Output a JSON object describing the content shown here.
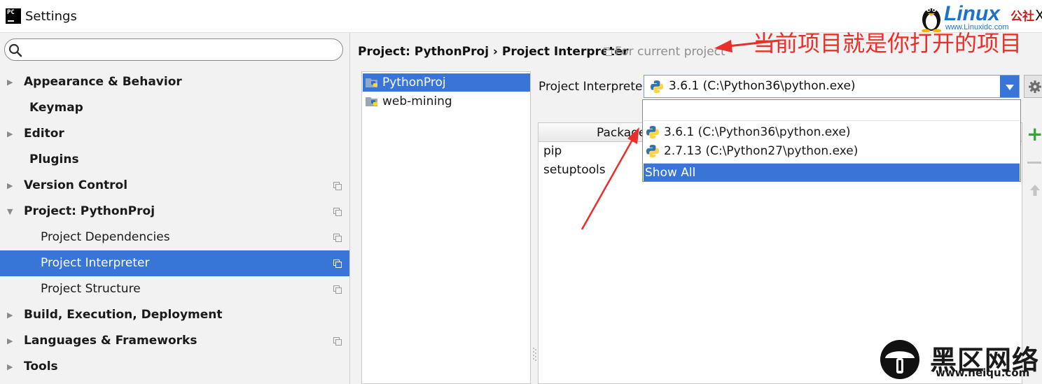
{
  "window": {
    "app_icon_text": "PC",
    "title": "Settings",
    "close_symbol": "X"
  },
  "watermark_top": {
    "brand": "Linux",
    "brand_cn": "公社",
    "url": "www.Linuxidc.com"
  },
  "search": {
    "placeholder": "",
    "value": ""
  },
  "sidebar": {
    "items": [
      {
        "label": "Appearance & Behavior",
        "arrow": "▶"
      },
      {
        "label": "Keymap"
      },
      {
        "label": "Editor",
        "arrow": "▶"
      },
      {
        "label": "Plugins"
      },
      {
        "label": "Version Control",
        "arrow": "▶"
      },
      {
        "label": "Project: PythonProj",
        "arrow": "▼"
      },
      {
        "label": "Project Dependencies"
      },
      {
        "label": "Project Interpreter"
      },
      {
        "label": "Project Structure"
      },
      {
        "label": "Build, Execution, Deployment",
        "arrow": "▶"
      },
      {
        "label": "Languages & Frameworks",
        "arrow": "▶"
      },
      {
        "label": "Tools",
        "arrow": "▶"
      }
    ]
  },
  "breadcrumb": {
    "text": "Project: PythonProj › Project Interpreter",
    "scope": "For current project"
  },
  "projects": [
    "PythonProj",
    "web-mining"
  ],
  "interpreter": {
    "label": "Project Interpreter:",
    "value": "3.6.1 (C:\\Python36\\python.exe)"
  },
  "packages": {
    "header": "Package",
    "rows": [
      "pip",
      "setuptools"
    ]
  },
  "dropdown": {
    "options": [
      "3.6.1 (C:\\Python36\\python.exe)",
      "2.7.13 (C:\\Python27\\python.exe)"
    ],
    "show_all": "Show All"
  },
  "toolbar": {
    "add_symbol": "+"
  },
  "annotation": {
    "text": "当前项目就是你打开的项目"
  },
  "watermark_bottom": {
    "brand_cn": "黑区网络",
    "url": "www.heiqu.com"
  },
  "colors": {
    "selection": "#3875d7",
    "annotation": "#e8302b",
    "add_green": "#3ba13b"
  }
}
